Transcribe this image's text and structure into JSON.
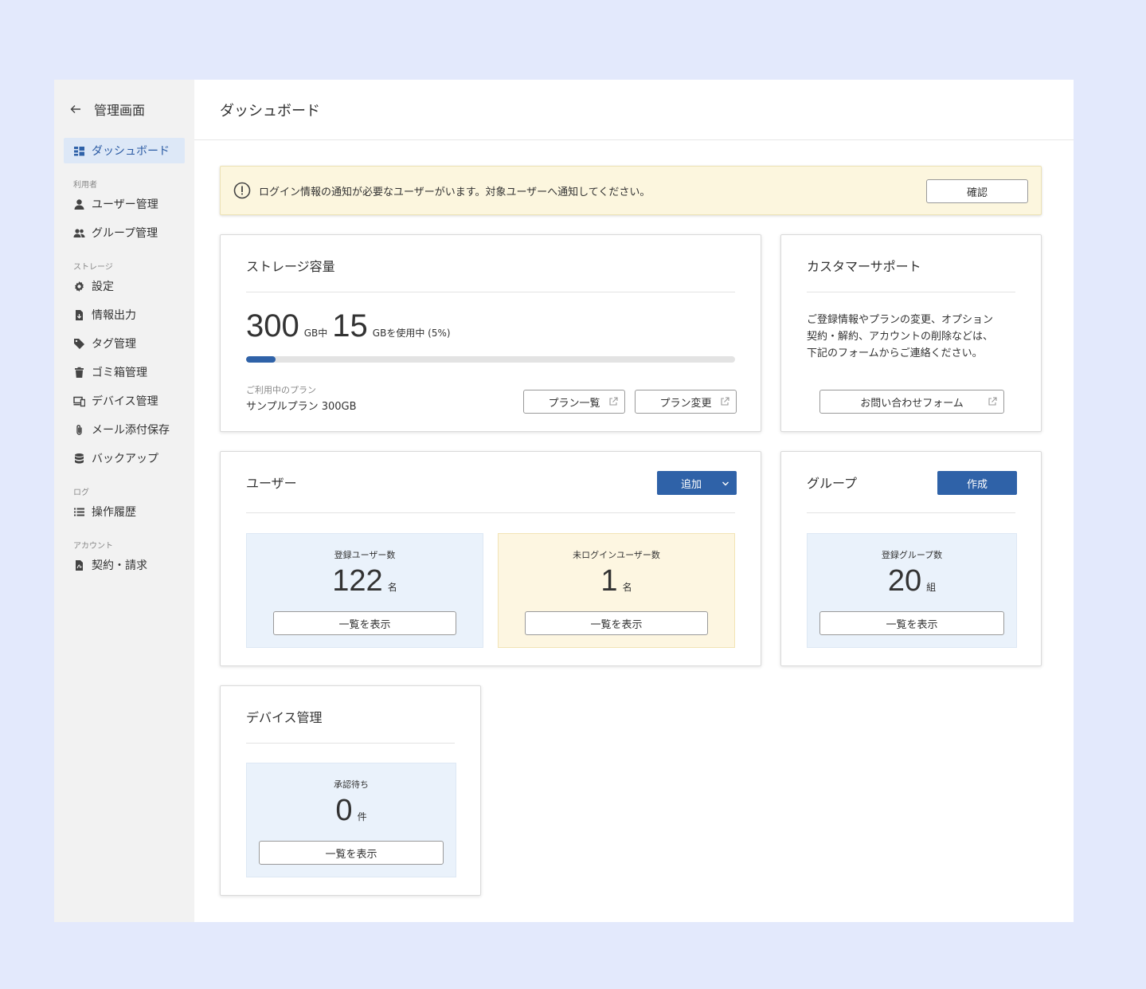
{
  "sidebar": {
    "back_label": "管理画面",
    "items": [
      {
        "label": "ダッシュボード",
        "icon": "dashboard-icon",
        "active": true
      },
      {
        "label": "ユーザー管理",
        "icon": "user-icon"
      },
      {
        "label": "グループ管理",
        "icon": "group-icon"
      },
      {
        "label": "設定",
        "icon": "gear-icon"
      },
      {
        "label": "情報出力",
        "icon": "file-export-icon"
      },
      {
        "label": "タグ管理",
        "icon": "tag-icon"
      },
      {
        "label": "ゴミ箱管理",
        "icon": "trash-icon"
      },
      {
        "label": "デバイス管理",
        "icon": "devices-icon"
      },
      {
        "label": "メール添付保存",
        "icon": "paperclip-icon"
      },
      {
        "label": "バックアップ",
        "icon": "database-icon"
      },
      {
        "label": "操作履歴",
        "icon": "list-icon"
      },
      {
        "label": "契約・請求",
        "icon": "contract-file-icon"
      }
    ],
    "sections": [
      "利用者",
      "ストレージ",
      "ログ",
      "アカウント"
    ]
  },
  "header": {
    "title": "ダッシュボード"
  },
  "alert": {
    "text": "ログイン情報の通知が必要なユーザーがいます。対象ユーザーへ通知してください。",
    "button": "確認"
  },
  "storage": {
    "title": "ストレージ容量",
    "total": "300",
    "total_unit": "GB中",
    "used": "15",
    "used_unit": "GBを使用中 (5%)",
    "used_fraction": 0.05,
    "plan_label": "ご利用中のプラン",
    "plan_name": "サンプルプラン 300GB",
    "btn_plan_list": "プラン一覧",
    "btn_plan_change": "プラン変更"
  },
  "support": {
    "title": "カスタマーサポート",
    "text_line1": "ご登録情報やプランの変更、オプション",
    "text_line2": "契約・解約、アカウントの削除などは、",
    "text_line3": "下記のフォームからご連絡ください。",
    "button": "お問い合わせフォーム"
  },
  "users": {
    "title": "ユーザー",
    "add_button": "追加",
    "registered": {
      "label": "登録ユーザー数",
      "value": "122",
      "unit": "名",
      "button": "一覧を表示"
    },
    "not_logged_in": {
      "label": "未ログインユーザー数",
      "value": "1",
      "unit": "名",
      "button": "一覧を表示"
    }
  },
  "groups": {
    "title": "グループ",
    "create_button": "作成",
    "registered": {
      "label": "登録グループ数",
      "value": "20",
      "unit": "組",
      "button": "一覧を表示"
    }
  },
  "devices": {
    "title": "デバイス管理",
    "pending": {
      "label": "承認待ち",
      "value": "0",
      "unit": "件",
      "button": "一覧を表示"
    }
  },
  "colors": {
    "accent": "#2f62a8",
    "background": "#e3e9fc",
    "alert_bg": "#fcf6de",
    "stat_blue": "#eaf2fb",
    "stat_yellow": "#fdf6e1"
  }
}
